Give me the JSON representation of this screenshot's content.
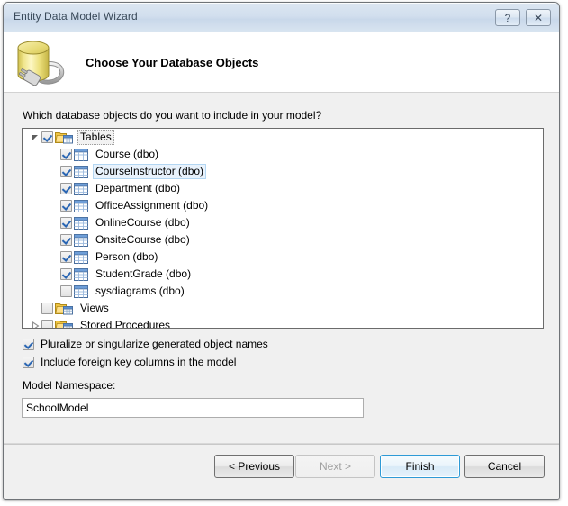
{
  "window": {
    "title": "Entity Data Model Wizard",
    "help_button": "?",
    "close_button": "✕"
  },
  "header": {
    "title": "Choose Your Database Objects",
    "icon": "database-plug-icon"
  },
  "body": {
    "prompt": "Which database objects do you want to include in your model?"
  },
  "tree": {
    "nodes": [
      {
        "label": "Tables",
        "level": 0,
        "checked": true,
        "expander": "expanded",
        "icon": "folder-tables-icon",
        "selected": false,
        "focused": true
      },
      {
        "label": "Course (dbo)",
        "level": 1,
        "checked": true,
        "expander": "none",
        "icon": "table-grid-icon",
        "selected": false,
        "focused": false
      },
      {
        "label": "CourseInstructor (dbo)",
        "level": 1,
        "checked": true,
        "expander": "none",
        "icon": "table-grid-icon",
        "selected": true,
        "focused": false
      },
      {
        "label": "Department (dbo)",
        "level": 1,
        "checked": true,
        "expander": "none",
        "icon": "table-grid-icon",
        "selected": false,
        "focused": false
      },
      {
        "label": "OfficeAssignment (dbo)",
        "level": 1,
        "checked": true,
        "expander": "none",
        "icon": "table-grid-icon",
        "selected": false,
        "focused": false
      },
      {
        "label": "OnlineCourse (dbo)",
        "level": 1,
        "checked": true,
        "expander": "none",
        "icon": "table-grid-icon",
        "selected": false,
        "focused": false
      },
      {
        "label": "OnsiteCourse (dbo)",
        "level": 1,
        "checked": true,
        "expander": "none",
        "icon": "table-grid-icon",
        "selected": false,
        "focused": false
      },
      {
        "label": "Person (dbo)",
        "level": 1,
        "checked": true,
        "expander": "none",
        "icon": "table-grid-icon",
        "selected": false,
        "focused": false
      },
      {
        "label": "StudentGrade (dbo)",
        "level": 1,
        "checked": true,
        "expander": "none",
        "icon": "table-grid-icon",
        "selected": false,
        "focused": false
      },
      {
        "label": "sysdiagrams (dbo)",
        "level": 1,
        "checked": false,
        "expander": "none",
        "icon": "table-grid-icon",
        "selected": false,
        "focused": false
      },
      {
        "label": "Views",
        "level": 0,
        "checked": false,
        "expander": "none",
        "icon": "folder-views-icon",
        "selected": false,
        "focused": false
      },
      {
        "label": "Stored Procedures",
        "level": 0,
        "checked": false,
        "expander": "collapsed",
        "icon": "folder-procedures-icon",
        "selected": false,
        "focused": false
      }
    ]
  },
  "options": {
    "pluralize": {
      "label": "Pluralize or singularize generated object names",
      "checked": true
    },
    "foreign_keys": {
      "label": "Include foreign key columns in the model",
      "checked": true
    }
  },
  "namespace": {
    "label": "Model Namespace:",
    "value": "SchoolModel"
  },
  "footer": {
    "previous": "< Previous",
    "next": "Next >",
    "finish": "Finish",
    "cancel": "Cancel"
  },
  "colors": {
    "titlebar": "#d2dfee",
    "dialog_bg": "#f0f0f0",
    "header_bg": "#ffffff",
    "checkbox_check": "#2a66b3",
    "default_button_outline": "#2e9ad6",
    "selection_bg": "#e8f2fc",
    "db_icon_yellow": "#e8da6a"
  }
}
